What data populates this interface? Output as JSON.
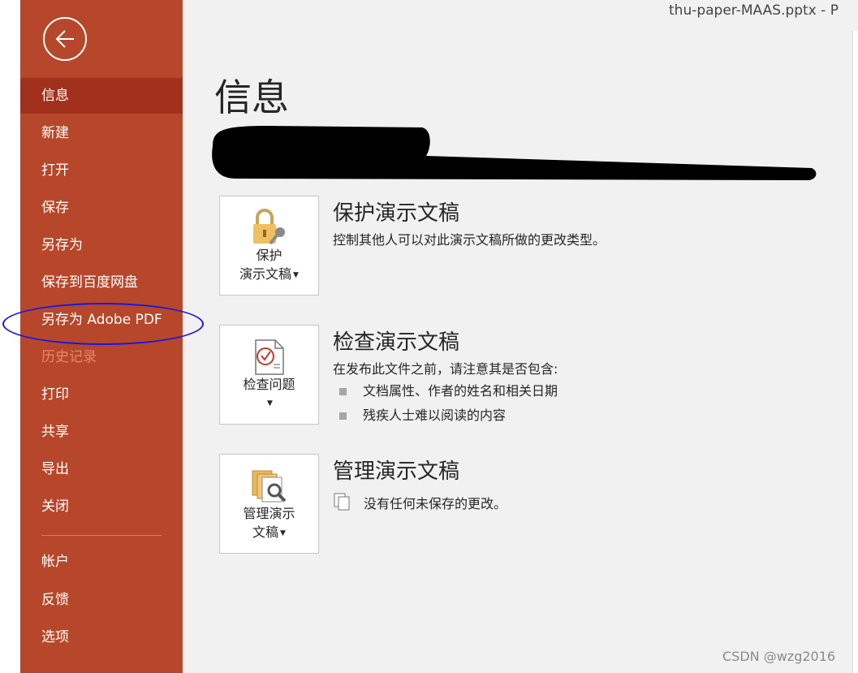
{
  "window": {
    "title": "thu-paper-MAAS.pptx  -  P"
  },
  "sidebar": {
    "items": [
      {
        "label": "信息"
      },
      {
        "label": "新建"
      },
      {
        "label": "打开"
      },
      {
        "label": "保存"
      },
      {
        "label": "另存为"
      },
      {
        "label": "保存到百度网盘"
      },
      {
        "label": "另存为 Adobe PDF"
      },
      {
        "label": "历史记录"
      },
      {
        "label": "打印"
      },
      {
        "label": "共享"
      },
      {
        "label": "导出"
      },
      {
        "label": "关闭"
      },
      {
        "label": "帐户"
      },
      {
        "label": "反馈"
      },
      {
        "label": "选项"
      }
    ]
  },
  "page": {
    "title": "信息"
  },
  "sections": {
    "protect": {
      "tile_line1": "保护",
      "tile_line2": "演示文稿",
      "heading": "保护演示文稿",
      "description": "控制其他人可以对此演示文稿所做的更改类型。"
    },
    "inspect": {
      "tile_label": "检查问题",
      "heading": "检查演示文稿",
      "description": "在发布此文件之前，请注意其是否包含:",
      "bullets": [
        "文档属性、作者的姓名和相关日期",
        "残疾人士难以阅读的内容"
      ]
    },
    "manage": {
      "tile_line1": "管理演示",
      "tile_line2": "文稿",
      "heading": "管理演示文稿",
      "description": "没有任何未保存的更改。"
    }
  },
  "watermark": "CSDN @wzg2016",
  "colors": {
    "sidebar": "#b7472a",
    "sidebar_active": "#a1311d",
    "annotation": "#1818e0"
  }
}
